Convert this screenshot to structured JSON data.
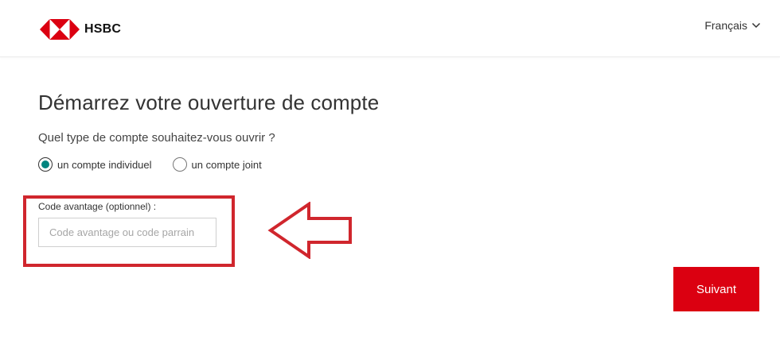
{
  "header": {
    "brand": "HSBC",
    "language": "Français",
    "brand_color": "#db0011"
  },
  "main": {
    "title": "Démarrez votre ouverture de compte",
    "question": "Quel type de compte souhaitez-vous ouvrir ?",
    "account_types": [
      {
        "label": "un compte individuel",
        "selected": true
      },
      {
        "label": "un compte joint",
        "selected": false
      }
    ],
    "promo_code": {
      "label": "Code avantage (optionnel) :",
      "placeholder": "Code avantage ou code parrain",
      "value": ""
    },
    "next_label": "Suivant"
  },
  "annotation": {
    "highlight_color": "#d0262d",
    "arrow_direction": "left"
  },
  "colors": {
    "radio_selected": "#00847f",
    "button_bg": "#db0011"
  }
}
